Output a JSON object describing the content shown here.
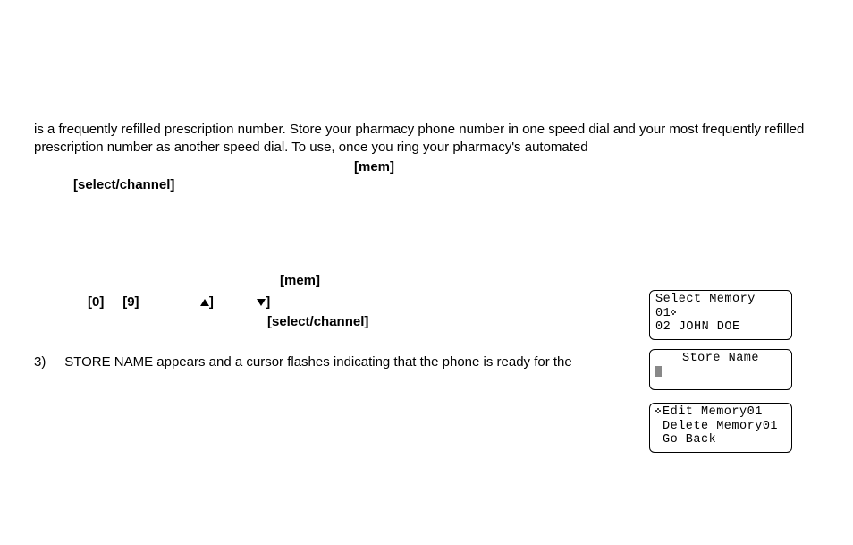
{
  "intro": {
    "line1": "is a frequently refilled prescription number. Store your pharmacy phone number in one speed dial and your most ",
    "line2": "frequently refilled prescription number as another speed dial. To use, once you ring your pharmacy's automated"
  },
  "keys": {
    "mem": "[mem]",
    "select_channel": "[select/channel]",
    "zero": "[0]",
    "nine": "[9]"
  },
  "step3": {
    "num": "3)",
    "text": "STORE NAME appears and a cursor flashes indicating that the phone is ready for the"
  },
  "lcd": {
    "select_memory": {
      "title": "Select Memory",
      "row1": "01",
      "row2": "02 JOHN DOE"
    },
    "store_name": {
      "title": "Store Name"
    },
    "edit_menu": {
      "row1": "Edit Memory01",
      "row2": "Delete Memory01",
      "row3": "Go Back"
    }
  }
}
